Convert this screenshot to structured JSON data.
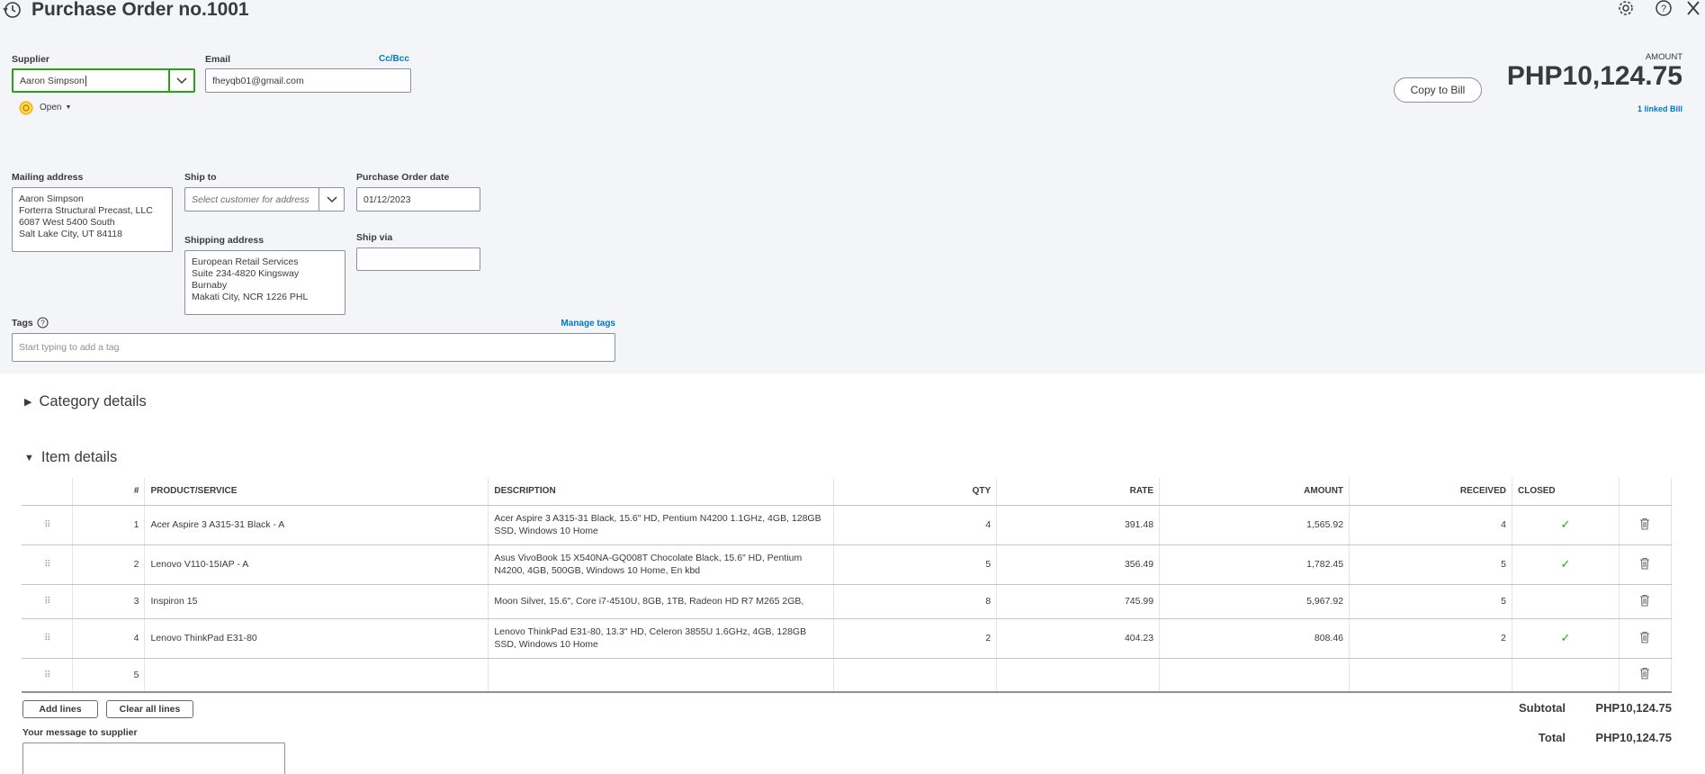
{
  "header": {
    "title": "Purchase Order no.1001"
  },
  "supplier": {
    "label": "Supplier",
    "value": "Aaron Simpson"
  },
  "email": {
    "label": "Email",
    "value": "fheyqb01@gmail.com",
    "cc_bcc": "Cc/Bcc"
  },
  "status": {
    "label": "Open"
  },
  "amount": {
    "label": "AMOUNT",
    "value": "PHP10,124.75",
    "linked": "1 linked Bill",
    "copy_button": "Copy to Bill"
  },
  "mailing": {
    "label": "Mailing address",
    "lines": [
      "Aaron Simpson",
      "Forterra Structural Precast, LLC",
      "6087 West 5400 South",
      "Salt Lake City, UT  84118"
    ]
  },
  "ship_to": {
    "label": "Ship to",
    "placeholder": "Select customer for address"
  },
  "shipping": {
    "label": "Shipping address",
    "lines": [
      "European Retail Services",
      "Suite 234-4820 Kingsway",
      "Burnaby",
      "Makati City, NCR  1226 PHL"
    ]
  },
  "po_date": {
    "label": "Purchase Order date",
    "value": "01/12/2023"
  },
  "ship_via": {
    "label": "Ship via",
    "value": ""
  },
  "tags": {
    "label": "Tags",
    "manage": "Manage tags",
    "placeholder": "Start typing to add a tag"
  },
  "sections": {
    "category": "Category details",
    "items": "Item details"
  },
  "table": {
    "headers": {
      "num": "#",
      "product": "PRODUCT/SERVICE",
      "description": "DESCRIPTION",
      "qty": "QTY",
      "rate": "RATE",
      "amount": "AMOUNT",
      "received": "RECEIVED",
      "closed": "CLOSED"
    },
    "rows": [
      {
        "num": "1",
        "product": "Acer Aspire 3 A315-31 Black - A",
        "description": "Acer Aspire 3 A315-31 Black, 15.6\" HD, Pentium N4200 1.1GHz, 4GB, 128GB SSD, Windows 10 Home",
        "qty": "4",
        "rate": "391.48",
        "amount": "1,565.92",
        "received": "4",
        "closed": true
      },
      {
        "num": "2",
        "product": "Lenovo V110-15IAP - A",
        "description": "Asus VivoBook 15 X540NA-GQ008T Chocolate Black, 15.6\" HD, Pentium N4200, 4GB, 500GB, Windows 10 Home, En kbd",
        "qty": "5",
        "rate": "356.49",
        "amount": "1,782.45",
        "received": "5",
        "closed": true
      },
      {
        "num": "3",
        "product": "Inspiron 15",
        "description": "Moon Silver, 15.6\", Core i7-4510U, 8GB, 1TB, Radeon HD R7 M265 2GB,",
        "qty": "8",
        "rate": "745.99",
        "amount": "5,967.92",
        "received": "5",
        "closed": false
      },
      {
        "num": "4",
        "product": "Lenovo ThinkPad E31-80",
        "description": "Lenovo ThinkPad E31-80, 13.3\" HD, Celeron 3855U 1.6GHz, 4GB, 128GB SSD, Windows 10 Home",
        "qty": "2",
        "rate": "404.23",
        "amount": "808.46",
        "received": "2",
        "closed": true
      },
      {
        "num": "5",
        "product": "",
        "description": "",
        "qty": "",
        "rate": "",
        "amount": "",
        "received": "",
        "closed": false
      }
    ]
  },
  "buttons": {
    "add_lines": "Add lines",
    "clear_lines": "Clear all lines"
  },
  "message": {
    "label": "Your message to supplier"
  },
  "totals": {
    "subtotal_label": "Subtotal",
    "subtotal_value": "PHP10,124.75",
    "total_label": "Total",
    "total_value": "PHP10,124.75"
  },
  "colors": {
    "accent_green": "#2ca01c",
    "link_blue": "#0077c5",
    "header_bg": "#f4f5f8"
  }
}
